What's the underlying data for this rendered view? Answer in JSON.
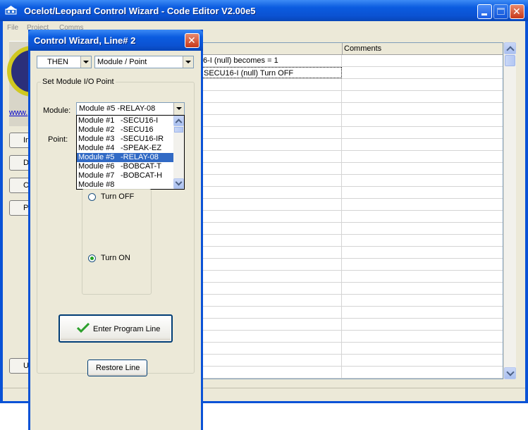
{
  "main_window": {
    "title": "Ocelot/Leopard Control Wizard - Code Editor V2.00e5",
    "menu": [
      "File",
      "Project",
      "Comms"
    ],
    "link_text": "www.",
    "side_buttons": [
      "Ins",
      "De",
      "Cl",
      "P",
      "U"
    ],
    "grid": {
      "comments_header": "Comments",
      "rows": [
        {
          "code": "6-I (null) becomes =  1",
          "comment": ""
        },
        {
          "code": "SECU16-I (null) Turn OFF",
          "comment": ""
        }
      ]
    }
  },
  "wizard": {
    "title": "Control Wizard, Line# 2",
    "then_select": "THEN",
    "type_select": "Module / Point",
    "group_label": "Set Module I/O Point",
    "module_label": "Module:",
    "module_value": "Module #5   -RELAY-08",
    "point_label": "Point:",
    "module_options": [
      {
        "module": "Module #1",
        "type": "-SECU16-I"
      },
      {
        "module": "Module #2",
        "type": "-SECU16"
      },
      {
        "module": "Module #3",
        "type": "-SECU16-IR"
      },
      {
        "module": "Module #4",
        "type": "-SPEAK-EZ"
      },
      {
        "module": "Module #5",
        "type": "-RELAY-08"
      },
      {
        "module": "Module #6",
        "type": "-BOBCAT-T"
      },
      {
        "module": "Module #7",
        "type": "-BOBCAT-H"
      },
      {
        "module": "Module #8",
        "type": ""
      }
    ],
    "selected_option_index": 4,
    "radio_off": "Turn OFF",
    "radio_on": "Turn ON",
    "selected_radio": "Turn ON",
    "enter_button": "Enter Program Line",
    "restore_button": "Restore Line"
  },
  "colors": {
    "xp_blue": "#0a52d6",
    "dialog_face": "#ece9d8",
    "selection": "#316ac5",
    "close_red": "#c8381a"
  },
  "icons": [
    "app-icon",
    "minimize-icon",
    "maximize-icon",
    "close-icon",
    "check-icon",
    "chevron-up-icon",
    "chevron-down-icon"
  ]
}
